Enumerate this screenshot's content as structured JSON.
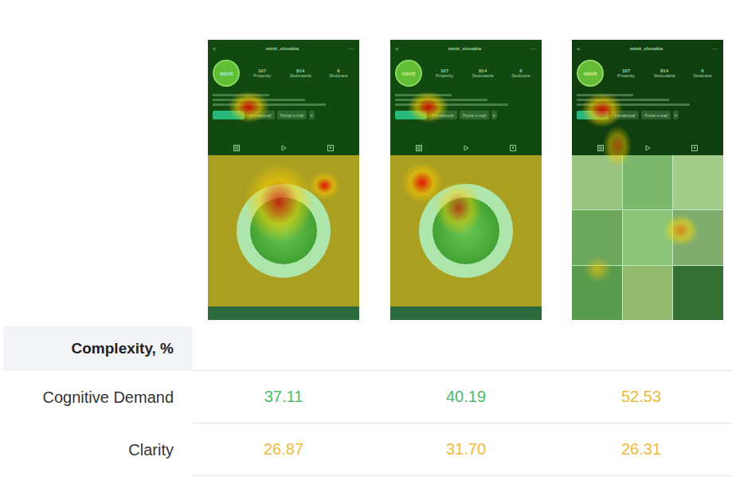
{
  "screens": [
    {
      "kind": "promo",
      "back": "<",
      "account": "minit_slovakia",
      "more": "···",
      "logo": "minit",
      "stats": [
        {
          "value": "107",
          "label": "Príspevky"
        },
        {
          "value": "814",
          "label": "Sledovatelia"
        },
        {
          "value": "6",
          "label": "Sledované"
        }
      ],
      "buttons": [
        "Kontaktovať",
        "Poslať e-mail"
      ],
      "dropdown": "▾"
    },
    {
      "kind": "promo",
      "back": "<",
      "account": "minit_slovakia",
      "more": "···",
      "logo": "minit",
      "stats": [
        {
          "value": "107",
          "label": "Príspevky"
        },
        {
          "value": "814",
          "label": "Sledovatelia"
        },
        {
          "value": "6",
          "label": "Sledované"
        }
      ],
      "buttons": [
        "Kontaktovať",
        "Poslať e-mail"
      ],
      "dropdown": "▾"
    },
    {
      "kind": "grid",
      "back": "<",
      "account": "minit_slovakia",
      "more": "···",
      "logo": "minit",
      "stats": [
        {
          "value": "107",
          "label": "Príspevky"
        },
        {
          "value": "814",
          "label": "Sledovatelia"
        },
        {
          "value": "6",
          "label": "Sledované"
        }
      ],
      "buttons": [
        "Kontaktovať",
        "Poslať e-mail"
      ],
      "dropdown": "▾"
    }
  ],
  "table": {
    "section": "Complexity, %",
    "rows": [
      {
        "label": "Cognitive Demand",
        "values": [
          {
            "text": "37.11",
            "color": "#4cb86e"
          },
          {
            "text": "40.19",
            "color": "#4cb86e"
          },
          {
            "text": "52.53",
            "color": "#f0b93a"
          }
        ]
      },
      {
        "label": "Clarity",
        "values": [
          {
            "text": "26.87",
            "color": "#f0b93a"
          },
          {
            "text": "31.70",
            "color": "#f0b93a"
          },
          {
            "text": "26.31",
            "color": "#f0b93a"
          }
        ]
      }
    ]
  }
}
